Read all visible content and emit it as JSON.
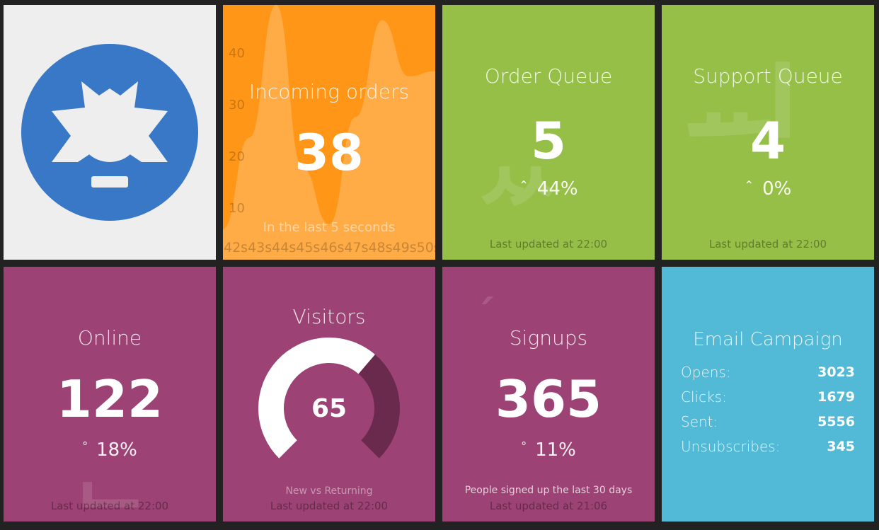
{
  "colors": {
    "background": "#222222",
    "logo_tile": "#eeeeee",
    "logo_blue": "#3878c7",
    "orange": "#ff9618",
    "green": "#96bf48",
    "purple": "#9c4274",
    "blue": "#52b9d6",
    "gauge_remainder": "#6a2a4d"
  },
  "logo": {
    "icon": "lightbulb-sun-icon"
  },
  "incoming_orders": {
    "title": "Incoming orders",
    "value": "38",
    "more_info": "In the last 5 seconds",
    "chart_data": {
      "type": "area",
      "x": [
        "42s",
        "43s",
        "44s",
        "45s",
        "46s",
        "47s",
        "48s",
        "49s",
        "50s"
      ],
      "y_ticks": [
        "40",
        "30",
        "20",
        "10"
      ],
      "values": [
        6,
        24,
        50,
        18,
        7,
        28,
        47,
        36,
        37
      ]
    }
  },
  "order_queue": {
    "title": "Order Queue",
    "value": "5",
    "change": "44%",
    "change_icon": "arrow-up-icon",
    "updated": "Last updated at 22:00"
  },
  "support_queue": {
    "title": "Support Queue",
    "value": "4",
    "change": "0%",
    "change_icon": "arrow-up-icon",
    "updated": "Last updated at 22:00"
  },
  "online": {
    "title": "Online",
    "value": "122",
    "change": "18%",
    "change_icon": "arrow-down-icon",
    "updated": "Last updated at 22:00"
  },
  "visitors": {
    "title": "Visitors",
    "value": "65",
    "percent": 65,
    "more_info": "New vs Returning",
    "updated": "Last updated at 22:00"
  },
  "signups": {
    "title": "Signups",
    "value": "365",
    "change": "11%",
    "change_icon": "arrow-down-icon",
    "more_info": "People signed up the last 30 days",
    "updated": "Last updated at 21:06"
  },
  "email_campaign": {
    "title": "Email Campaign",
    "items": [
      {
        "label": "Opens:",
        "value": "3023"
      },
      {
        "label": "Clicks:",
        "value": "1679"
      },
      {
        "label": "Sent:",
        "value": "5556"
      },
      {
        "label": "Unsubscribes:",
        "value": "345"
      }
    ]
  }
}
